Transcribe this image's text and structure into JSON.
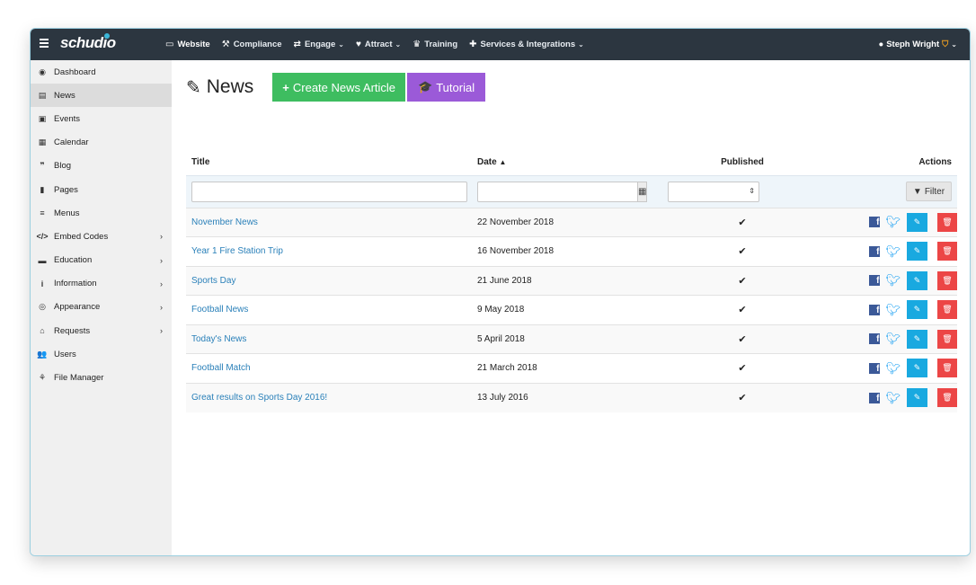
{
  "app": {
    "brand": "schudio",
    "nav": [
      {
        "label": "Website",
        "icon": "monitor-icon",
        "chevron": false,
        "active": true
      },
      {
        "label": "Compliance",
        "icon": "gavel-icon",
        "chevron": false
      },
      {
        "label": "Engage",
        "icon": "exchange-icon",
        "chevron": true
      },
      {
        "label": "Attract",
        "icon": "heart-icon",
        "chevron": true
      },
      {
        "label": "Training",
        "icon": "trophy-icon",
        "chevron": false
      },
      {
        "label": "Services & Integrations",
        "icon": "puzzle-icon",
        "chevron": true
      }
    ],
    "user": {
      "name": "Steph Wright",
      "icon": "user-circle-icon",
      "badge": "shield-icon"
    }
  },
  "sidebar": {
    "items": [
      {
        "label": "Dashboard",
        "icon": "dashboard-icon",
        "arrow": false
      },
      {
        "label": "News",
        "icon": "newspaper-icon",
        "arrow": false,
        "active": true
      },
      {
        "label": "Events",
        "icon": "calendar-event-icon",
        "arrow": false
      },
      {
        "label": "Calendar",
        "icon": "calendar-icon",
        "arrow": false
      },
      {
        "label": "Blog",
        "icon": "quote-icon",
        "arrow": false
      },
      {
        "label": "Pages",
        "icon": "file-icon",
        "arrow": false
      },
      {
        "label": "Menus",
        "icon": "bars-icon",
        "arrow": false
      },
      {
        "label": "Embed Codes",
        "icon": "code-icon",
        "arrow": true
      },
      {
        "label": "Education",
        "icon": "book-icon",
        "arrow": true
      },
      {
        "label": "Information",
        "icon": "info-icon",
        "arrow": true
      },
      {
        "label": "Appearance",
        "icon": "eye-icon",
        "arrow": true
      },
      {
        "label": "Requests",
        "icon": "inbox-icon",
        "arrow": true
      },
      {
        "label": "Users",
        "icon": "users-icon",
        "arrow": false
      },
      {
        "label": "File Manager",
        "icon": "sitemap-icon",
        "arrow": false
      }
    ]
  },
  "page": {
    "title": "News",
    "create_label": "Create News Article",
    "tutorial_label": "Tutorial"
  },
  "table": {
    "headers": {
      "title": "Title",
      "date": "Date",
      "published": "Published",
      "actions": "Actions"
    },
    "filter_label": "Filter",
    "rows": [
      {
        "title": "November News",
        "date": "22 November 2018",
        "published": true
      },
      {
        "title": "Year 1 Fire Station Trip",
        "date": "16 November 2018",
        "published": true
      },
      {
        "title": "Sports Day",
        "date": "21 June 2018",
        "published": true
      },
      {
        "title": "Football News",
        "date": "9 May 2018",
        "published": true
      },
      {
        "title": "Today's News",
        "date": "5 April 2018",
        "published": true
      },
      {
        "title": "Football Match",
        "date": "21 March 2018",
        "published": true
      },
      {
        "title": "Great results on Sports Day 2016!",
        "date": "13 July 2016",
        "published": true
      }
    ]
  },
  "colors": {
    "topbar": "#2c3640",
    "create": "#3ebd60",
    "tutorial": "#9b5ad8",
    "link": "#2a80b9",
    "edit": "#19a9e0",
    "delete": "#ec4646"
  }
}
